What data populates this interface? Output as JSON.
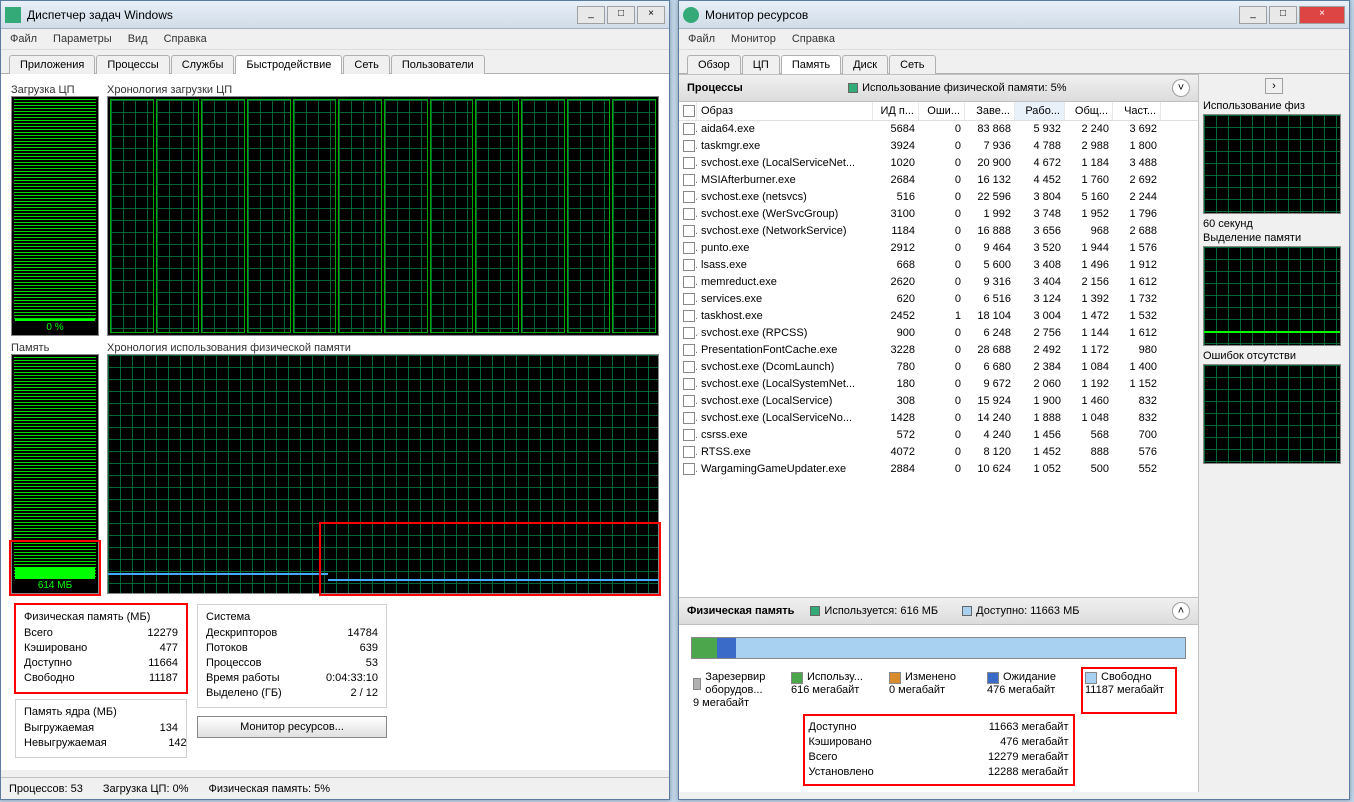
{
  "tm": {
    "title": "Диспетчер задач Windows",
    "menu": [
      "Файл",
      "Параметры",
      "Вид",
      "Справка"
    ],
    "tabs": [
      "Приложения",
      "Процессы",
      "Службы",
      "Быстродействие",
      "Сеть",
      "Пользователи"
    ],
    "active_tab": 3,
    "labels": {
      "cpu_load": "Загрузка ЦП",
      "cpu_hist": "Хронология загрузки ЦП",
      "memory": "Память",
      "mem_hist": "Хронология использования физической памяти"
    },
    "cpu_pct": "0 %",
    "mem_value": "614 МБ",
    "phys_mem": {
      "title": "Физическая память (МБ)",
      "rows": [
        {
          "l": "Всего",
          "v": "12279"
        },
        {
          "l": "Кэшировано",
          "v": "477"
        },
        {
          "l": "Доступно",
          "v": "11664"
        },
        {
          "l": "Свободно",
          "v": "11187"
        }
      ]
    },
    "kernel_mem": {
      "title": "Память ядра (МБ)",
      "rows": [
        {
          "l": "Выгружаемая",
          "v": "134"
        },
        {
          "l": "Невыгружаемая",
          "v": "142"
        }
      ]
    },
    "system": {
      "title": "Система",
      "rows": [
        {
          "l": "Дескрипторов",
          "v": "14784"
        },
        {
          "l": "Потоков",
          "v": "639"
        },
        {
          "l": "Процессов",
          "v": "53"
        },
        {
          "l": "Время работы",
          "v": "0:04:33:10"
        },
        {
          "l": "Выделено (ГБ)",
          "v": "2 / 12"
        }
      ]
    },
    "monitor_btn": "Монитор ресурсов...",
    "status": {
      "processes": "Процессов: 53",
      "cpu": "Загрузка ЦП: 0%",
      "mem": "Физическая память: 5%"
    }
  },
  "rm": {
    "title": "Монитор ресурсов",
    "menu": [
      "Файл",
      "Монитор",
      "Справка"
    ],
    "tabs": [
      "Обзор",
      "ЦП",
      "Память",
      "Диск",
      "Сеть"
    ],
    "active_tab": 2,
    "proc_panel": {
      "title": "Процессы",
      "summary": "Использование физической памяти: 5%"
    },
    "columns": [
      "",
      "Образ",
      "ИД п...",
      "Оши...",
      "Заве...",
      "Рабо...",
      "Общ...",
      "Част..."
    ],
    "processes": [
      {
        "name": "aida64.exe",
        "pid": "5684",
        "c1": "0",
        "c2": "83 868",
        "c3": "5 932",
        "c4": "2 240",
        "c5": "3 692"
      },
      {
        "name": "taskmgr.exe",
        "pid": "3924",
        "c1": "0",
        "c2": "7 936",
        "c3": "4 788",
        "c4": "2 988",
        "c5": "1 800"
      },
      {
        "name": "svchost.exe (LocalServiceNet...",
        "pid": "1020",
        "c1": "0",
        "c2": "20 900",
        "c3": "4 672",
        "c4": "1 184",
        "c5": "3 488"
      },
      {
        "name": "MSIAfterburner.exe",
        "pid": "2684",
        "c1": "0",
        "c2": "16 132",
        "c3": "4 452",
        "c4": "1 760",
        "c5": "2 692"
      },
      {
        "name": "svchost.exe (netsvcs)",
        "pid": "516",
        "c1": "0",
        "c2": "22 596",
        "c3": "3 804",
        "c4": "5 160",
        "c5": "2 244"
      },
      {
        "name": "svchost.exe (WerSvcGroup)",
        "pid": "3100",
        "c1": "0",
        "c2": "1 992",
        "c3": "3 748",
        "c4": "1 952",
        "c5": "1 796"
      },
      {
        "name": "svchost.exe (NetworkService)",
        "pid": "1184",
        "c1": "0",
        "c2": "16 888",
        "c3": "3 656",
        "c4": "968",
        "c5": "2 688"
      },
      {
        "name": "punto.exe",
        "pid": "2912",
        "c1": "0",
        "c2": "9 464",
        "c3": "3 520",
        "c4": "1 944",
        "c5": "1 576"
      },
      {
        "name": "lsass.exe",
        "pid": "668",
        "c1": "0",
        "c2": "5 600",
        "c3": "3 408",
        "c4": "1 496",
        "c5": "1 912"
      },
      {
        "name": "memreduct.exe",
        "pid": "2620",
        "c1": "0",
        "c2": "9 316",
        "c3": "3 404",
        "c4": "2 156",
        "c5": "1 612"
      },
      {
        "name": "services.exe",
        "pid": "620",
        "c1": "0",
        "c2": "6 516",
        "c3": "3 124",
        "c4": "1 392",
        "c5": "1 732"
      },
      {
        "name": "taskhost.exe",
        "pid": "2452",
        "c1": "1",
        "c2": "18 104",
        "c3": "3 004",
        "c4": "1 472",
        "c5": "1 532"
      },
      {
        "name": "svchost.exe (RPCSS)",
        "pid": "900",
        "c1": "0",
        "c2": "6 248",
        "c3": "2 756",
        "c4": "1 144",
        "c5": "1 612"
      },
      {
        "name": "PresentationFontCache.exe",
        "pid": "3228",
        "c1": "0",
        "c2": "28 688",
        "c3": "2 492",
        "c4": "1 172",
        "c5": "980"
      },
      {
        "name": "svchost.exe (DcomLaunch)",
        "pid": "780",
        "c1": "0",
        "c2": "6 680",
        "c3": "2 384",
        "c4": "1 084",
        "c5": "1 400"
      },
      {
        "name": "svchost.exe (LocalSystemNet...",
        "pid": "180",
        "c1": "0",
        "c2": "9 672",
        "c3": "2 060",
        "c4": "1 192",
        "c5": "1 152"
      },
      {
        "name": "svchost.exe (LocalService)",
        "pid": "308",
        "c1": "0",
        "c2": "15 924",
        "c3": "1 900",
        "c4": "1 460",
        "c5": "832"
      },
      {
        "name": "svchost.exe (LocalServiceNo...",
        "pid": "1428",
        "c1": "0",
        "c2": "14 240",
        "c3": "1 888",
        "c4": "1 048",
        "c5": "832"
      },
      {
        "name": "csrss.exe",
        "pid": "572",
        "c1": "0",
        "c2": "4 240",
        "c3": "1 456",
        "c4": "568",
        "c5": "700"
      },
      {
        "name": "RTSS.exe",
        "pid": "4072",
        "c1": "0",
        "c2": "8 120",
        "c3": "1 452",
        "c4": "888",
        "c5": "576"
      },
      {
        "name": "WargamingGameUpdater.exe",
        "pid": "2884",
        "c1": "0",
        "c2": "10 624",
        "c3": "1 052",
        "c4": "500",
        "c5": "552"
      }
    ],
    "phys_panel": {
      "title": "Физическая память",
      "used": "Используется: 616 МБ",
      "avail": "Доступно: 11663 МБ"
    },
    "legend": [
      {
        "name": "Зарезервир оборудов...",
        "val": "9 мегабайт",
        "color": "#b0b0b0",
        "pct": 0
      },
      {
        "name": "Использу...",
        "val": "616 мегабайт",
        "color": "#4ca64c",
        "pct": 5
      },
      {
        "name": "Изменено",
        "val": "0 мегабайт",
        "color": "#d98c2e",
        "pct": 0
      },
      {
        "name": "Ожидание",
        "val": "476 мегабайт",
        "color": "#3b6bc9",
        "pct": 4
      },
      {
        "name": "Свободно",
        "val": "11187 мегабайт",
        "color": "#a8d0f0",
        "pct": 91
      }
    ],
    "summary": [
      {
        "l": "Доступно",
        "v": "11663 мегабайт"
      },
      {
        "l": "Кэшировано",
        "v": "476 мегабайт"
      },
      {
        "l": "Всего",
        "v": "12279 мегабайт"
      },
      {
        "l": "Установлено",
        "v": "12288 мегабайт"
      }
    ],
    "side": {
      "chart1": "Использование физ",
      "axis": "60 секунд",
      "chart2": "Выделение памяти",
      "chart3": "Ошибок отсутстви"
    }
  }
}
